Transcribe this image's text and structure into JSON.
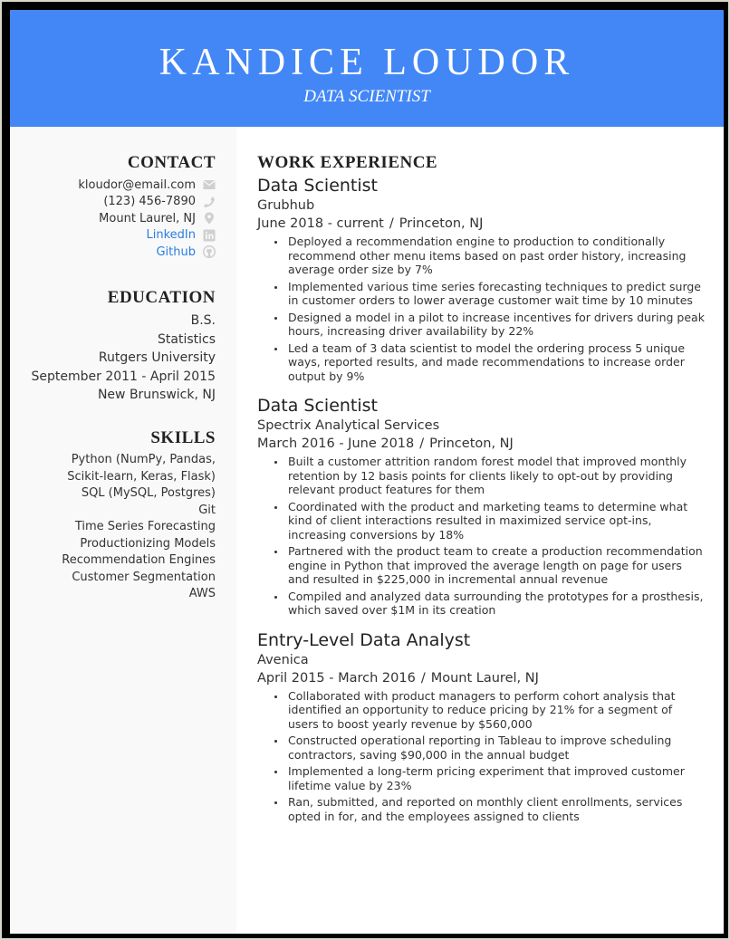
{
  "header": {
    "name": "KANDICE LOUDOR",
    "title": "DATA SCIENTIST",
    "accent_color": "#4287f5"
  },
  "sidebar": {
    "contact": {
      "heading": "CONTACT",
      "items": [
        {
          "value": "kloudor@email.com",
          "icon": "envelope-icon",
          "link": false
        },
        {
          "value": "(123) 456-7890",
          "icon": "phone-icon",
          "link": false
        },
        {
          "value": "Mount Laurel, NJ",
          "icon": "map-pin-icon",
          "link": false
        },
        {
          "value": "LinkedIn",
          "icon": "linkedin-icon",
          "link": true
        },
        {
          "value": "Github",
          "icon": "github-icon",
          "link": true
        }
      ]
    },
    "education": {
      "heading": "EDUCATION",
      "degree": "B.S.",
      "field": "Statistics",
      "school": "Rutgers University",
      "dates": "September 2011 - April 2015",
      "location": "New Brunswick, NJ"
    },
    "skills": {
      "heading": "SKILLS",
      "items": [
        "Python (NumPy, Pandas, Scikit-learn, Keras, Flask)",
        "SQL (MySQL, Postgres)",
        "Git",
        "Time Series Forecasting",
        "Productionizing Models",
        "Recommendation Engines",
        "Customer Segmentation",
        "AWS"
      ]
    }
  },
  "work": {
    "heading": "WORK EXPERIENCE",
    "jobs": [
      {
        "title": "Data Scientist",
        "company": "Grubhub",
        "dates": "June 2018 - current",
        "separator": "/",
        "location": "Princeton, NJ",
        "bullets": [
          "Deployed a recommendation engine to production to conditionally recommend other menu items based on past order history, increasing average order size by 7%",
          "Implemented various time series forecasting techniques to predict surge in customer orders to lower average customer wait time by 10 minutes",
          "Designed a model in a pilot to increase incentives for drivers during peak hours, increasing driver availability by 22%",
          "Led a team of 3 data scientist to model the ordering process 5 unique ways, reported results, and made recommendations to increase order output by 9%"
        ]
      },
      {
        "title": "Data Scientist",
        "company": "Spectrix Analytical Services",
        "dates": "March 2016 - June 2018",
        "separator": "/",
        "location": "Princeton, NJ",
        "bullets": [
          "Built a customer attrition random forest model that improved monthly retention by 12 basis points for clients likely to opt-out by providing relevant product features for them",
          "Coordinated with the product and marketing teams to determine what kind of client interactions resulted in maximized service opt-ins, increasing conversions by 18%",
          "Partnered with the product team to create a production recommendation engine in Python that improved the average length on page for users and resulted in $225,000 in incremental annual revenue",
          "Compiled and analyzed data surrounding the prototypes for a prosthesis, which saved over $1M in its creation"
        ]
      },
      {
        "title": "Entry-Level Data Analyst",
        "company": "Avenica",
        "dates": "April 2015 - March 2016",
        "separator": "/",
        "location": "Mount Laurel, NJ",
        "bullets": [
          "Collaborated with product managers to perform cohort analysis that identified an opportunity to reduce pricing by 21% for a segment of users to boost yearly revenue by $560,000",
          "Constructed operational reporting in Tableau to improve scheduling contractors, saving $90,000 in the annual budget",
          "Implemented a long-term pricing experiment that improved customer lifetime value by 23%",
          "Ran, submitted, and reported on monthly client enrollments, services opted in for, and the employees assigned to clients"
        ]
      }
    ]
  }
}
